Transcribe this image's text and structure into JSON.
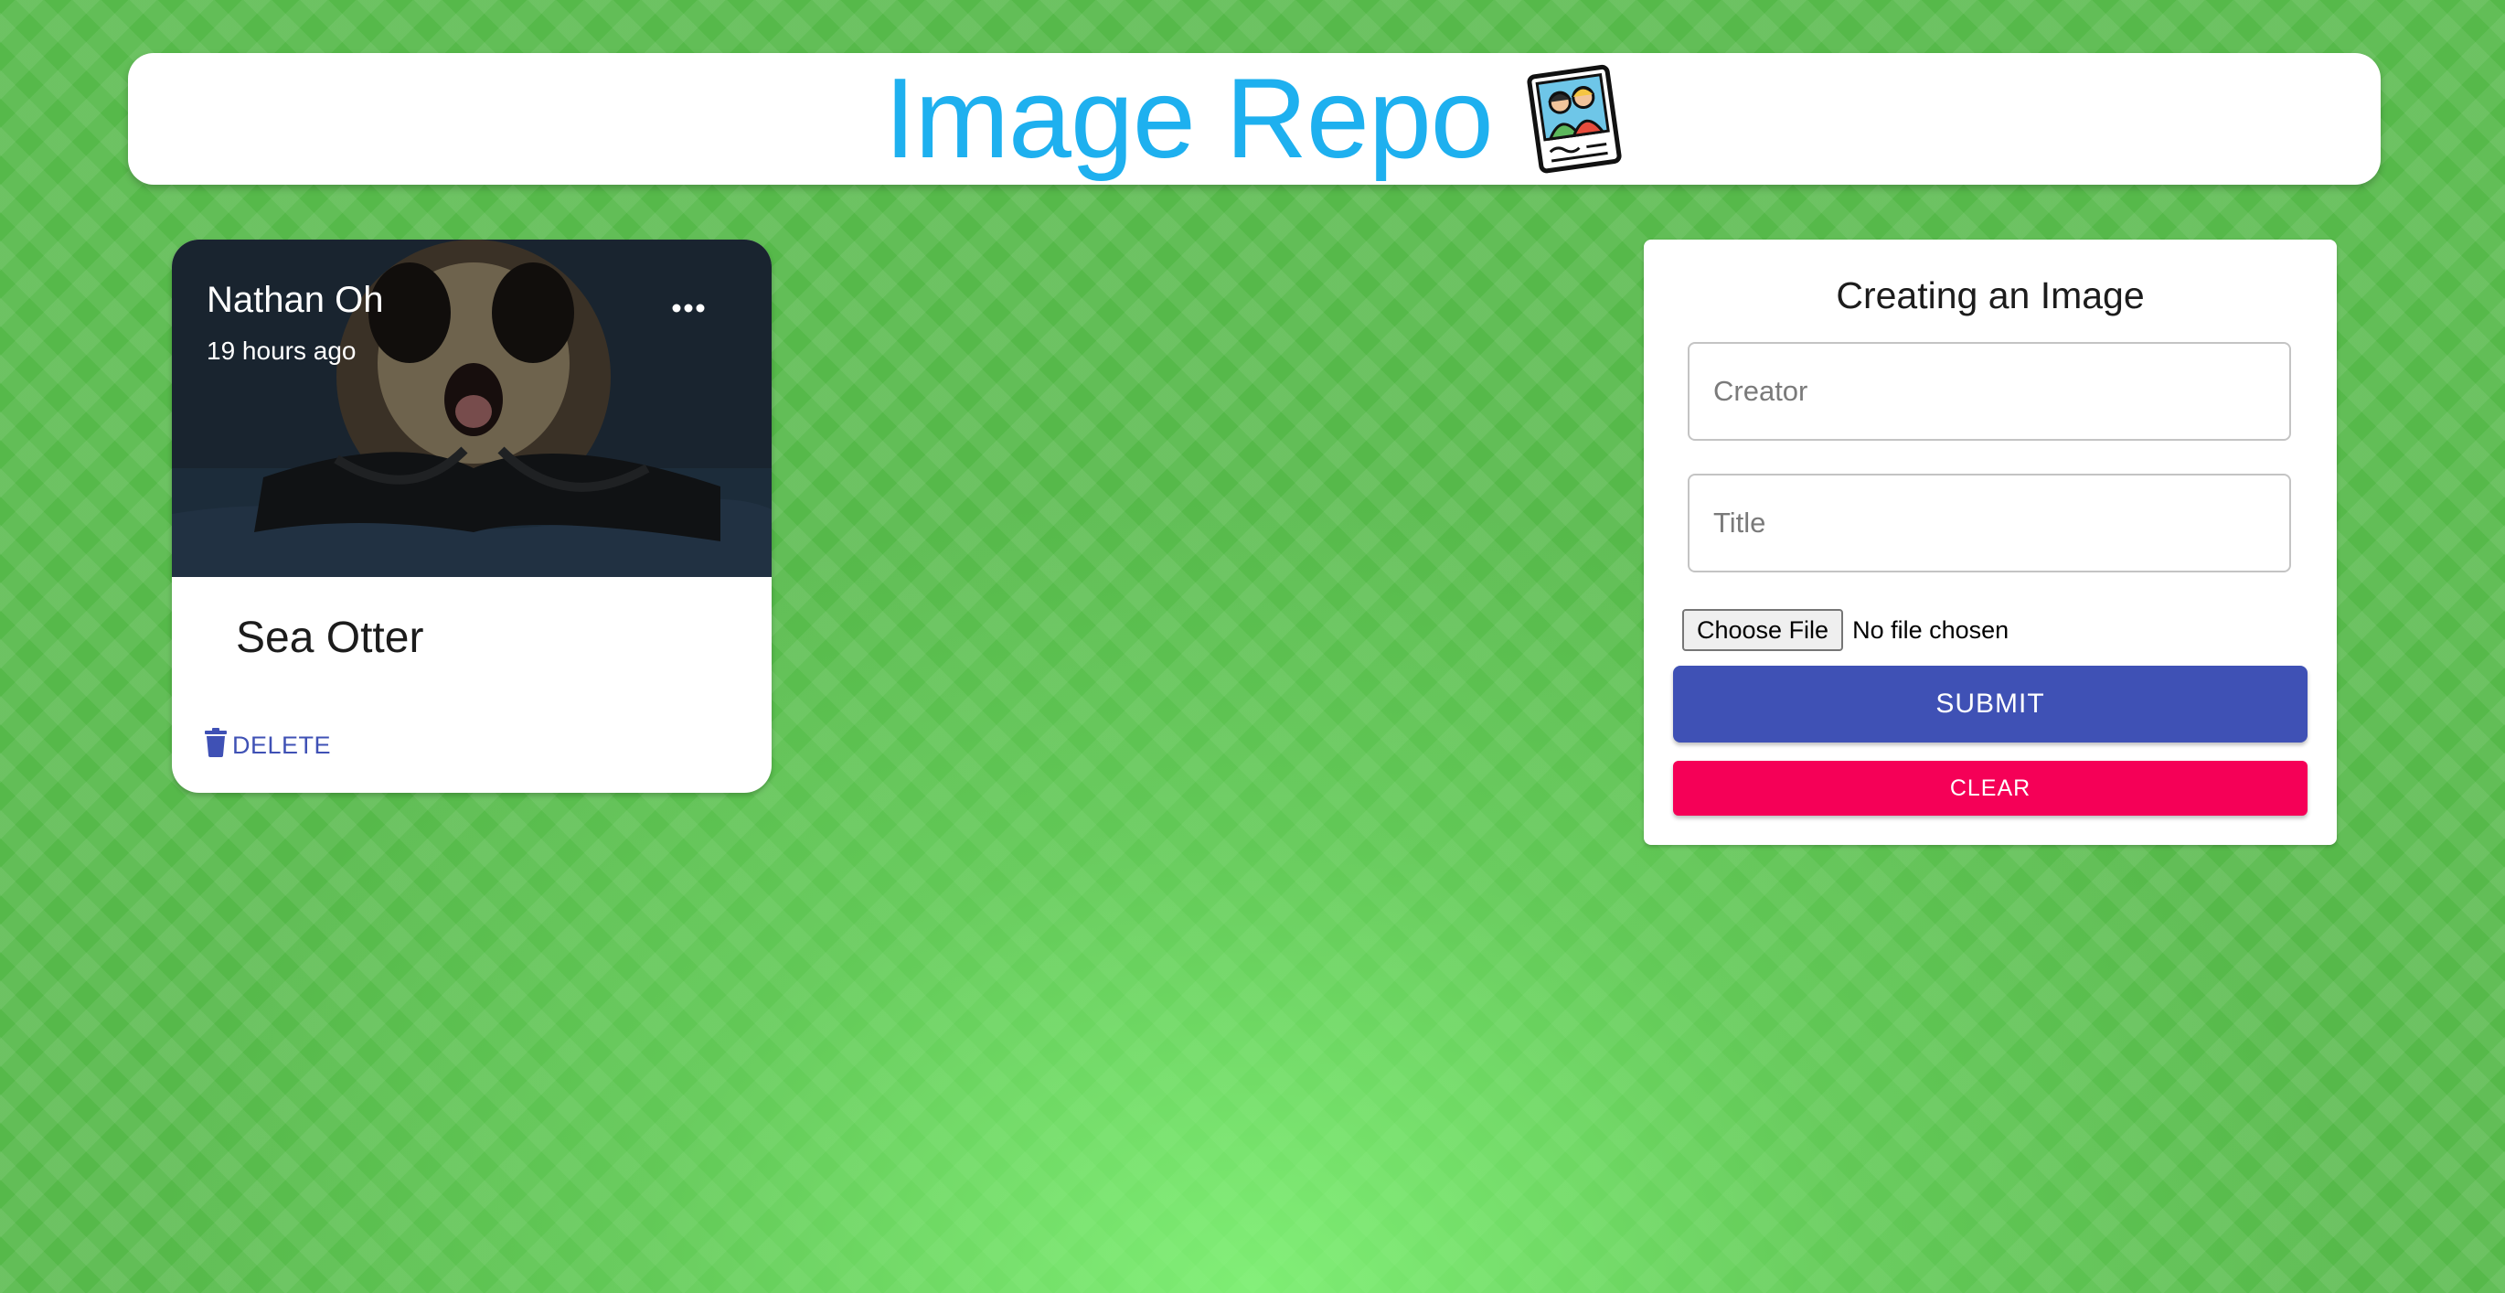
{
  "header": {
    "title": "Image Repo",
    "logo_icon": "photo-polaroid-icon",
    "title_color": "#1eb0ef"
  },
  "post": {
    "creator": "Nathan Oh",
    "time_ago": "19 hours ago",
    "title": "Sea Otter",
    "image_icon": "sea-otter-photo",
    "more_icon": "more-horizontal-icon",
    "delete_label": "DELETE",
    "delete_icon": "trash-icon",
    "accent_color": "#3f51b5"
  },
  "form": {
    "heading": "Creating an Image",
    "creator": {
      "value": "",
      "placeholder": "Creator"
    },
    "title": {
      "value": "",
      "placeholder": "Title"
    },
    "file": {
      "button_label": "Choose File",
      "status": "No file chosen"
    },
    "submit_label": "SUBMIT",
    "clear_label": "CLEAR",
    "submit_color": "#3f51b5",
    "clear_color": "#f50057"
  }
}
